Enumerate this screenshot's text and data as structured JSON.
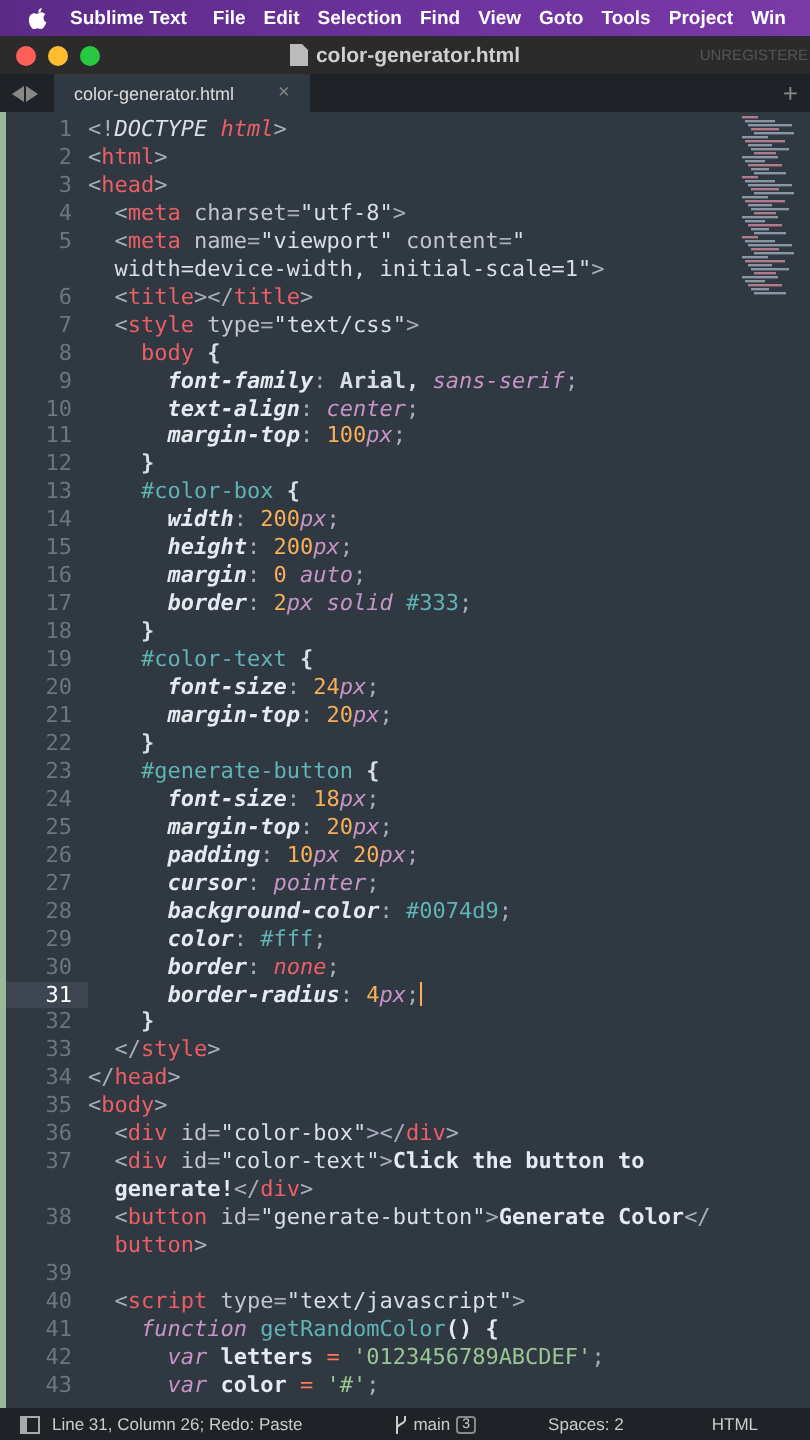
{
  "menu_bar": {
    "app_name": "Sublime Text",
    "items": [
      "File",
      "Edit",
      "Selection",
      "Find",
      "View",
      "Goto",
      "Tools",
      "Project",
      "Win"
    ]
  },
  "window": {
    "title": "color-generator.html",
    "watermark": "UNREGISTERE"
  },
  "tabs": [
    {
      "label": "color-generator.html",
      "close": "×",
      "selected": true
    }
  ],
  "new_tab": "+",
  "editor": {
    "lines": [
      {
        "number": "1",
        "current": false,
        "rows": [
          {
            "tokens": [
              {
                "kind": "punct",
                "text": "<!"
              },
              {
                "kind": "doctype",
                "text": "DOCTYPE"
              },
              {
                "kind": "tagi",
                "text": " html"
              },
              {
                "kind": "punct",
                "text": ">"
              }
            ]
          }
        ]
      },
      {
        "number": "2",
        "current": false,
        "rows": [
          {
            "tokens": [
              {
                "kind": "punct",
                "text": "<"
              },
              {
                "kind": "tag",
                "text": "html"
              },
              {
                "kind": "punct",
                "text": ">"
              }
            ]
          }
        ]
      },
      {
        "number": "3",
        "current": false,
        "rows": [
          {
            "tokens": [
              {
                "kind": "punct",
                "text": "<"
              },
              {
                "kind": "tag",
                "text": "head"
              },
              {
                "kind": "punct",
                "text": ">"
              }
            ]
          }
        ]
      },
      {
        "number": "4",
        "current": false,
        "rows": [
          {
            "tokens": [
              {
                "kind": "punct",
                "text": "  <"
              },
              {
                "kind": "tag",
                "text": "meta"
              },
              {
                "kind": "attr",
                "text": " charset"
              },
              {
                "kind": "punct",
                "text": "="
              },
              {
                "kind": "string",
                "text": "\"utf-8\""
              },
              {
                "kind": "punct",
                "text": ">"
              }
            ]
          }
        ]
      },
      {
        "number": "5",
        "current": false,
        "rows": [
          {
            "tokens": [
              {
                "kind": "punct",
                "text": "  <"
              },
              {
                "kind": "tag",
                "text": "meta"
              },
              {
                "kind": "attr",
                "text": " name"
              },
              {
                "kind": "punct",
                "text": "="
              },
              {
                "kind": "string",
                "text": "\"viewport\""
              },
              {
                "kind": "attr",
                "text": " content"
              },
              {
                "kind": "punct",
                "text": "="
              },
              {
                "kind": "string",
                "text": "\""
              }
            ]
          },
          {
            "tokens": [
              {
                "kind": "string",
                "text": "  width=device-width, initial-scale=1\""
              },
              {
                "kind": "punct",
                "text": ">"
              }
            ]
          }
        ]
      },
      {
        "number": "6",
        "current": false,
        "rows": [
          {
            "tokens": [
              {
                "kind": "punct",
                "text": "  <"
              },
              {
                "kind": "tag",
                "text": "title"
              },
              {
                "kind": "punct",
                "text": "></"
              },
              {
                "kind": "tag",
                "text": "title"
              },
              {
                "kind": "punct",
                "text": ">"
              }
            ]
          }
        ]
      },
      {
        "number": "7",
        "current": false,
        "rows": [
          {
            "tokens": [
              {
                "kind": "punct",
                "text": "  <"
              },
              {
                "kind": "tag",
                "text": "style"
              },
              {
                "kind": "attr",
                "text": " type"
              },
              {
                "kind": "punct",
                "text": "="
              },
              {
                "kind": "string",
                "text": "\"text/css\""
              },
              {
                "kind": "punct",
                "text": ">"
              }
            ]
          }
        ]
      },
      {
        "number": "8",
        "current": false,
        "rows": [
          {
            "tokens": [
              {
                "kind": "tag",
                "text": "    body"
              },
              {
                "kind": "plain",
                "text": " {"
              }
            ]
          }
        ]
      },
      {
        "number": "9",
        "current": false,
        "rows": [
          {
            "tokens": [
              {
                "kind": "prop",
                "text": "      font-family"
              },
              {
                "kind": "punct",
                "text": ": "
              },
              {
                "kind": "plain",
                "text": "Arial, "
              },
              {
                "kind": "keyword",
                "text": "sans-serif"
              },
              {
                "kind": "punct",
                "text": ";"
              }
            ]
          }
        ]
      },
      {
        "number": "10",
        "current": false,
        "rows": [
          {
            "tokens": [
              {
                "kind": "prop",
                "text": "      text-align"
              },
              {
                "kind": "punct",
                "text": ": "
              },
              {
                "kind": "keyword",
                "text": "center"
              },
              {
                "kind": "punct",
                "text": ";"
              }
            ]
          }
        ]
      },
      {
        "number": "11",
        "current": false,
        "rows": [
          {
            "tokens": [
              {
                "kind": "prop",
                "text": "      margin-top"
              },
              {
                "kind": "punct",
                "text": ": "
              },
              {
                "kind": "number",
                "text": "100"
              },
              {
                "kind": "unit",
                "text": "px"
              },
              {
                "kind": "punct",
                "text": ";"
              }
            ]
          }
        ]
      },
      {
        "number": "12",
        "current": false,
        "rows": [
          {
            "tokens": [
              {
                "kind": "plain",
                "text": "    }"
              }
            ]
          }
        ]
      },
      {
        "number": "13",
        "current": false,
        "rows": [
          {
            "tokens": [
              {
                "kind": "selector",
                "text": "    #color-box"
              },
              {
                "kind": "plain",
                "text": " {"
              }
            ]
          }
        ]
      },
      {
        "number": "14",
        "current": false,
        "rows": [
          {
            "tokens": [
              {
                "kind": "prop",
                "text": "      width"
              },
              {
                "kind": "punct",
                "text": ": "
              },
              {
                "kind": "number",
                "text": "200"
              },
              {
                "kind": "unit",
                "text": "px"
              },
              {
                "kind": "punct",
                "text": ";"
              }
            ]
          }
        ]
      },
      {
        "number": "15",
        "current": false,
        "rows": [
          {
            "tokens": [
              {
                "kind": "prop",
                "text": "      height"
              },
              {
                "kind": "punct",
                "text": ": "
              },
              {
                "kind": "number",
                "text": "200"
              },
              {
                "kind": "unit",
                "text": "px"
              },
              {
                "kind": "punct",
                "text": ";"
              }
            ]
          }
        ]
      },
      {
        "number": "16",
        "current": false,
        "rows": [
          {
            "tokens": [
              {
                "kind": "prop",
                "text": "      margin"
              },
              {
                "kind": "punct",
                "text": ": "
              },
              {
                "kind": "number",
                "text": "0"
              },
              {
                "kind": "keyword",
                "text": " auto"
              },
              {
                "kind": "punct",
                "text": ";"
              }
            ]
          }
        ]
      },
      {
        "number": "17",
        "current": false,
        "rows": [
          {
            "tokens": [
              {
                "kind": "prop",
                "text": "      border"
              },
              {
                "kind": "punct",
                "text": ": "
              },
              {
                "kind": "number",
                "text": "2"
              },
              {
                "kind": "unit",
                "text": "px"
              },
              {
                "kind": "keyword",
                "text": " solid"
              },
              {
                "kind": "selector",
                "text": " #333"
              },
              {
                "kind": "punct",
                "text": ";"
              }
            ]
          }
        ]
      },
      {
        "number": "18",
        "current": false,
        "rows": [
          {
            "tokens": [
              {
                "kind": "plain",
                "text": "    }"
              }
            ]
          }
        ]
      },
      {
        "number": "19",
        "current": false,
        "rows": [
          {
            "tokens": [
              {
                "kind": "selector",
                "text": "    #color-text"
              },
              {
                "kind": "plain",
                "text": " {"
              }
            ]
          }
        ]
      },
      {
        "number": "20",
        "current": false,
        "rows": [
          {
            "tokens": [
              {
                "kind": "prop",
                "text": "      font-size"
              },
              {
                "kind": "punct",
                "text": ": "
              },
              {
                "kind": "number",
                "text": "24"
              },
              {
                "kind": "unit",
                "text": "px"
              },
              {
                "kind": "punct",
                "text": ";"
              }
            ]
          }
        ]
      },
      {
        "number": "21",
        "current": false,
        "rows": [
          {
            "tokens": [
              {
                "kind": "prop",
                "text": "      margin-top"
              },
              {
                "kind": "punct",
                "text": ": "
              },
              {
                "kind": "number",
                "text": "20"
              },
              {
                "kind": "unit",
                "text": "px"
              },
              {
                "kind": "punct",
                "text": ";"
              }
            ]
          }
        ]
      },
      {
        "number": "22",
        "current": false,
        "rows": [
          {
            "tokens": [
              {
                "kind": "plain",
                "text": "    }"
              }
            ]
          }
        ]
      },
      {
        "number": "23",
        "current": false,
        "rows": [
          {
            "tokens": [
              {
                "kind": "selector",
                "text": "    #generate-button"
              },
              {
                "kind": "plain",
                "text": " {"
              }
            ]
          }
        ]
      },
      {
        "number": "24",
        "current": false,
        "rows": [
          {
            "tokens": [
              {
                "kind": "prop",
                "text": "      font-size"
              },
              {
                "kind": "punct",
                "text": ": "
              },
              {
                "kind": "number",
                "text": "18"
              },
              {
                "kind": "unit",
                "text": "px"
              },
              {
                "kind": "punct",
                "text": ";"
              }
            ]
          }
        ]
      },
      {
        "number": "25",
        "current": false,
        "rows": [
          {
            "tokens": [
              {
                "kind": "prop",
                "text": "      margin-top"
              },
              {
                "kind": "punct",
                "text": ": "
              },
              {
                "kind": "number",
                "text": "20"
              },
              {
                "kind": "unit",
                "text": "px"
              },
              {
                "kind": "punct",
                "text": ";"
              }
            ]
          }
        ]
      },
      {
        "number": "26",
        "current": false,
        "rows": [
          {
            "tokens": [
              {
                "kind": "prop",
                "text": "      padding"
              },
              {
                "kind": "punct",
                "text": ": "
              },
              {
                "kind": "number",
                "text": "10"
              },
              {
                "kind": "unit",
                "text": "px"
              },
              {
                "kind": "number",
                "text": " 20"
              },
              {
                "kind": "unit",
                "text": "px"
              },
              {
                "kind": "punct",
                "text": ";"
              }
            ]
          }
        ]
      },
      {
        "number": "27",
        "current": false,
        "rows": [
          {
            "tokens": [
              {
                "kind": "prop",
                "text": "      cursor"
              },
              {
                "kind": "punct",
                "text": ": "
              },
              {
                "kind": "keyword",
                "text": "pointer"
              },
              {
                "kind": "punct",
                "text": ";"
              }
            ]
          }
        ]
      },
      {
        "number": "28",
        "current": false,
        "rows": [
          {
            "tokens": [
              {
                "kind": "prop",
                "text": "      background-color"
              },
              {
                "kind": "punct",
                "text": ": "
              },
              {
                "kind": "selector",
                "text": "#0074d9"
              },
              {
                "kind": "punct",
                "text": ";"
              }
            ]
          }
        ]
      },
      {
        "number": "29",
        "current": false,
        "rows": [
          {
            "tokens": [
              {
                "kind": "prop",
                "text": "      color"
              },
              {
                "kind": "punct",
                "text": ": "
              },
              {
                "kind": "selector",
                "text": "#fff"
              },
              {
                "kind": "punct",
                "text": ";"
              }
            ]
          }
        ]
      },
      {
        "number": "30",
        "current": false,
        "rows": [
          {
            "tokens": [
              {
                "kind": "prop",
                "text": "      border"
              },
              {
                "kind": "punct",
                "text": ": "
              },
              {
                "kind": "tagi",
                "text": "none"
              },
              {
                "kind": "punct",
                "text": ";"
              }
            ]
          }
        ]
      },
      {
        "number": "31",
        "current": true,
        "rows": [
          {
            "tokens": [
              {
                "kind": "prop",
                "text": "      border-radius"
              },
              {
                "kind": "punct",
                "text": ": "
              },
              {
                "kind": "number",
                "text": "4"
              },
              {
                "kind": "unit",
                "text": "px"
              },
              {
                "kind": "punct",
                "text": ";"
              }
            ]
          }
        ]
      },
      {
        "number": "32",
        "current": false,
        "rows": [
          {
            "tokens": [
              {
                "kind": "plain",
                "text": "    }"
              }
            ]
          }
        ]
      },
      {
        "number": "33",
        "current": false,
        "rows": [
          {
            "tokens": [
              {
                "kind": "punct",
                "text": "  </"
              },
              {
                "kind": "tag",
                "text": "style"
              },
              {
                "kind": "punct",
                "text": ">"
              }
            ]
          }
        ]
      },
      {
        "number": "34",
        "current": false,
        "rows": [
          {
            "tokens": [
              {
                "kind": "punct",
                "text": "</"
              },
              {
                "kind": "tag",
                "text": "head"
              },
              {
                "kind": "punct",
                "text": ">"
              }
            ]
          }
        ]
      },
      {
        "number": "35",
        "current": false,
        "rows": [
          {
            "tokens": [
              {
                "kind": "punct",
                "text": "<"
              },
              {
                "kind": "tag",
                "text": "body"
              },
              {
                "kind": "punct",
                "text": ">"
              }
            ]
          }
        ]
      },
      {
        "number": "36",
        "current": false,
        "rows": [
          {
            "tokens": [
              {
                "kind": "punct",
                "text": "  <"
              },
              {
                "kind": "tag",
                "text": "div"
              },
              {
                "kind": "attr",
                "text": " id"
              },
              {
                "kind": "punct",
                "text": "="
              },
              {
                "kind": "string",
                "text": "\"color-box\""
              },
              {
                "kind": "punct",
                "text": "></"
              },
              {
                "kind": "tag",
                "text": "div"
              },
              {
                "kind": "punct",
                "text": ">"
              }
            ]
          }
        ]
      },
      {
        "number": "37",
        "current": false,
        "rows": [
          {
            "tokens": [
              {
                "kind": "punct",
                "text": "  <"
              },
              {
                "kind": "tag",
                "text": "div"
              },
              {
                "kind": "attr",
                "text": " id"
              },
              {
                "kind": "punct",
                "text": "="
              },
              {
                "kind": "string",
                "text": "\"color-text\""
              },
              {
                "kind": "punct",
                "text": ">"
              },
              {
                "kind": "content",
                "text": "Click the button to"
              }
            ]
          },
          {
            "tokens": [
              {
                "kind": "content",
                "text": "  generate!"
              },
              {
                "kind": "punct",
                "text": "</"
              },
              {
                "kind": "tag",
                "text": "div"
              },
              {
                "kind": "punct",
                "text": ">"
              }
            ]
          }
        ]
      },
      {
        "number": "38",
        "current": false,
        "rows": [
          {
            "tokens": [
              {
                "kind": "punct",
                "text": "  <"
              },
              {
                "kind": "tag",
                "text": "button"
              },
              {
                "kind": "attr",
                "text": " id"
              },
              {
                "kind": "punct",
                "text": "="
              },
              {
                "kind": "string",
                "text": "\"generate-button\""
              },
              {
                "kind": "punct",
                "text": ">"
              },
              {
                "kind": "content",
                "text": "Generate Color"
              },
              {
                "kind": "punct",
                "text": "</"
              }
            ]
          },
          {
            "tokens": [
              {
                "kind": "tag",
                "text": "  button"
              },
              {
                "kind": "punct",
                "text": ">"
              }
            ]
          }
        ]
      },
      {
        "number": "39",
        "current": false
      },
      {
        "number": "40",
        "current": false,
        "rows": [
          {
            "tokens": [
              {
                "kind": "punct",
                "text": "  <"
              },
              {
                "kind": "tag",
                "text": "script"
              },
              {
                "kind": "attr",
                "text": " type"
              },
              {
                "kind": "punct",
                "text": "="
              },
              {
                "kind": "string",
                "text": "\"text/javascript\""
              },
              {
                "kind": "punct",
                "text": ">"
              }
            ]
          }
        ]
      },
      {
        "number": "41",
        "current": false,
        "rows": [
          {
            "tokens": [
              {
                "kind": "keyword",
                "text": "    function"
              },
              {
                "kind": "selector",
                "text": " getRandomColor"
              },
              {
                "kind": "content",
                "text": "() {"
              }
            ]
          }
        ]
      },
      {
        "number": "42",
        "current": false,
        "rows": [
          {
            "tokens": [
              {
                "kind": "keyword",
                "text": "      var"
              },
              {
                "kind": "content",
                "text": " letters"
              },
              {
                "kind": "op",
                "text": " ="
              },
              {
                "kind": "jsstring",
                "text": " '0123456789ABCDEF'"
              },
              {
                "kind": "punct",
                "text": ";"
              }
            ]
          }
        ]
      },
      {
        "number": "43",
        "current": false,
        "rows": [
          {
            "tokens": [
              {
                "kind": "keyword",
                "text": "      var"
              },
              {
                "kind": "content",
                "text": " color"
              },
              {
                "kind": "op",
                "text": " ="
              },
              {
                "kind": "jsstring",
                "text": " '#'"
              },
              {
                "kind": "punct",
                "text": ";"
              }
            ]
          }
        ]
      }
    ]
  },
  "status_bar": {
    "position": "Line 31, Column 26; Redo: Paste",
    "branch": "main",
    "changes": "3",
    "indentation": "Spaces: 2",
    "syntax": "HTML"
  }
}
